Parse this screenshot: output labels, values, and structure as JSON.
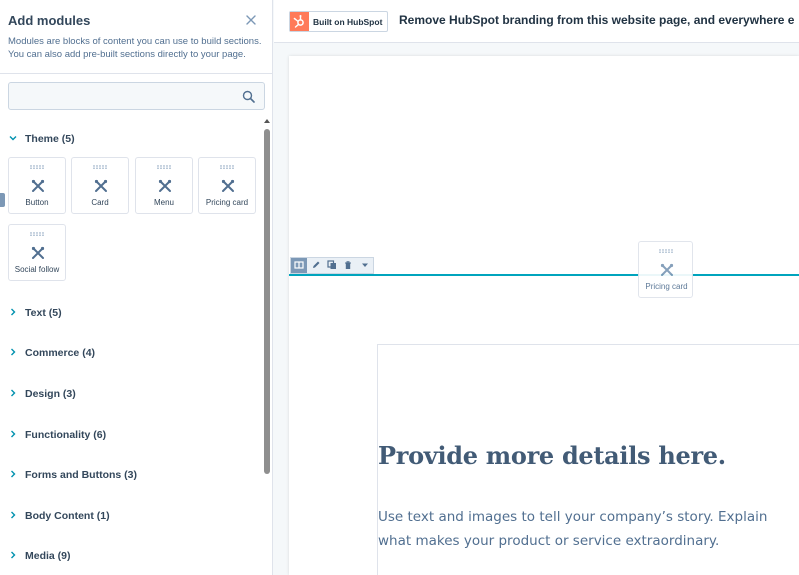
{
  "panel": {
    "title": "Add modules",
    "description_line1": "Modules are blocks of content you can use to build sections.",
    "description_line2": "You can also add pre-built sections directly to your page.",
    "search_placeholder": "",
    "close_icon": "close-icon"
  },
  "categories": [
    {
      "label": "Theme (5)",
      "expanded": true
    },
    {
      "label": "Text (5)",
      "expanded": false
    },
    {
      "label": "Commerce (4)",
      "expanded": false
    },
    {
      "label": "Design (3)",
      "expanded": false
    },
    {
      "label": "Functionality (6)",
      "expanded": false
    },
    {
      "label": "Forms and Buttons (3)",
      "expanded": false
    },
    {
      "label": "Body Content (1)",
      "expanded": false
    },
    {
      "label": "Media (9)",
      "expanded": false
    }
  ],
  "theme_modules": [
    "Button",
    "Card",
    "Menu",
    "Pricing card",
    "Social follow"
  ],
  "topbar": {
    "badge_text": "Built on HubSpot",
    "message": "Remove HubSpot branding from this website page, and everywhere e"
  },
  "drag_ghost": {
    "label": "Pricing card"
  },
  "content": {
    "heading": "Provide more details here.",
    "body_line1": "Use text and images to tell your company’s story. Explain",
    "body_line2": "what makes your product or service extraordinary."
  },
  "colors": {
    "accent": "#00a4bd",
    "hubspot_orange": "#ff7a59",
    "text_dark": "#33475b",
    "heading": "#425b76"
  }
}
